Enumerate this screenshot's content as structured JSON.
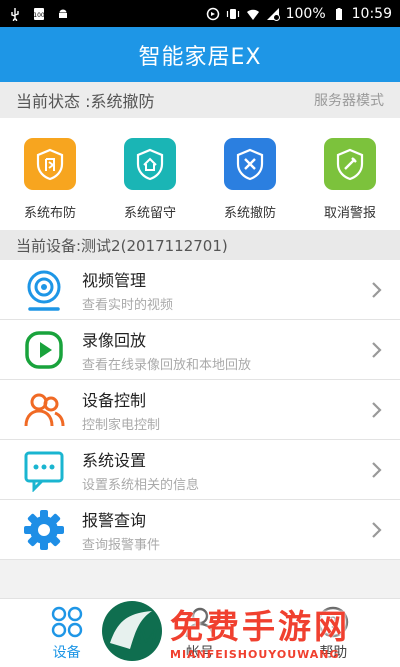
{
  "status_bar": {
    "battery": "100%",
    "time": "10:59"
  },
  "app_bar": {
    "title": "智能家居EX"
  },
  "current_state": {
    "label": "当前状态 :系统撤防",
    "mode": "服务器模式"
  },
  "actions": [
    {
      "label": "系统布防",
      "icon": "arm-icon",
      "color": "#f7a51f"
    },
    {
      "label": "系统留守",
      "icon": "stay-home-icon",
      "color": "#1ab5b5"
    },
    {
      "label": "系统撤防",
      "icon": "disarm-icon",
      "color": "#2b7fe0"
    },
    {
      "label": "取消警报",
      "icon": "cancel-alarm-icon",
      "color": "#7cc23c"
    }
  ],
  "device": {
    "label": "当前设备:测试2(2017112701)"
  },
  "menu": [
    {
      "title": "视频管理",
      "subtitle": "查看实时的视频",
      "icon": "camera-icon"
    },
    {
      "title": "录像回放",
      "subtitle": "查看在线录像回放和本地回放",
      "icon": "play-icon"
    },
    {
      "title": "设备控制",
      "subtitle": "控制家电控制",
      "icon": "people-icon"
    },
    {
      "title": "系统设置",
      "subtitle": "设置系统相关的信息",
      "icon": "message-icon"
    },
    {
      "title": "报警查询",
      "subtitle": "查询报警事件",
      "icon": "gear-icon"
    }
  ],
  "bottom_nav": [
    {
      "label": "设备",
      "icon": "devices-icon",
      "active": true
    },
    {
      "label": "帐号",
      "icon": "account-icon",
      "active": false
    },
    {
      "label": "帮助",
      "icon": "help-icon",
      "active": false
    }
  ],
  "watermark": {
    "title": "免费手游网",
    "subtitle": "MIANFEISHOUYOUWANG"
  }
}
